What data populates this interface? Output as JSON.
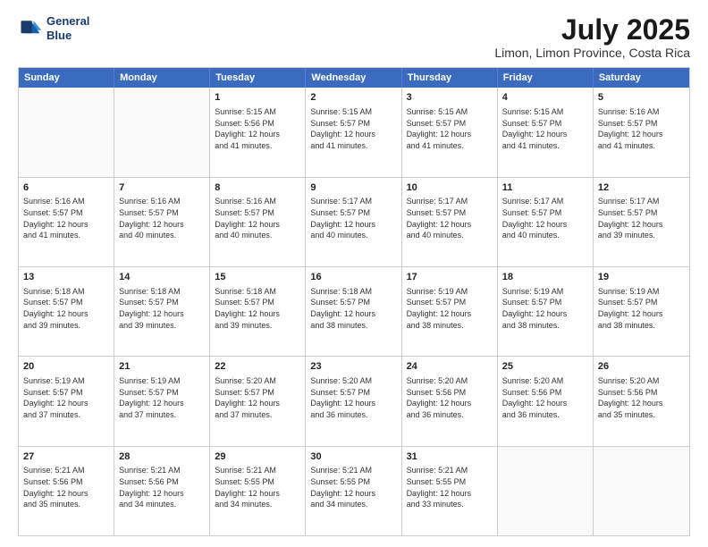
{
  "header": {
    "logo_line1": "General",
    "logo_line2": "Blue",
    "month": "July 2025",
    "location": "Limon, Limon Province, Costa Rica"
  },
  "weekdays": [
    "Sunday",
    "Monday",
    "Tuesday",
    "Wednesday",
    "Thursday",
    "Friday",
    "Saturday"
  ],
  "rows": [
    [
      {
        "day": "",
        "empty": true
      },
      {
        "day": "",
        "empty": true
      },
      {
        "day": "1",
        "line1": "Sunrise: 5:15 AM",
        "line2": "Sunset: 5:56 PM",
        "line3": "Daylight: 12 hours",
        "line4": "and 41 minutes."
      },
      {
        "day": "2",
        "line1": "Sunrise: 5:15 AM",
        "line2": "Sunset: 5:57 PM",
        "line3": "Daylight: 12 hours",
        "line4": "and 41 minutes."
      },
      {
        "day": "3",
        "line1": "Sunrise: 5:15 AM",
        "line2": "Sunset: 5:57 PM",
        "line3": "Daylight: 12 hours",
        "line4": "and 41 minutes."
      },
      {
        "day": "4",
        "line1": "Sunrise: 5:15 AM",
        "line2": "Sunset: 5:57 PM",
        "line3": "Daylight: 12 hours",
        "line4": "and 41 minutes."
      },
      {
        "day": "5",
        "line1": "Sunrise: 5:16 AM",
        "line2": "Sunset: 5:57 PM",
        "line3": "Daylight: 12 hours",
        "line4": "and 41 minutes."
      }
    ],
    [
      {
        "day": "6",
        "line1": "Sunrise: 5:16 AM",
        "line2": "Sunset: 5:57 PM",
        "line3": "Daylight: 12 hours",
        "line4": "and 41 minutes."
      },
      {
        "day": "7",
        "line1": "Sunrise: 5:16 AM",
        "line2": "Sunset: 5:57 PM",
        "line3": "Daylight: 12 hours",
        "line4": "and 40 minutes."
      },
      {
        "day": "8",
        "line1": "Sunrise: 5:16 AM",
        "line2": "Sunset: 5:57 PM",
        "line3": "Daylight: 12 hours",
        "line4": "and 40 minutes."
      },
      {
        "day": "9",
        "line1": "Sunrise: 5:17 AM",
        "line2": "Sunset: 5:57 PM",
        "line3": "Daylight: 12 hours",
        "line4": "and 40 minutes."
      },
      {
        "day": "10",
        "line1": "Sunrise: 5:17 AM",
        "line2": "Sunset: 5:57 PM",
        "line3": "Daylight: 12 hours",
        "line4": "and 40 minutes."
      },
      {
        "day": "11",
        "line1": "Sunrise: 5:17 AM",
        "line2": "Sunset: 5:57 PM",
        "line3": "Daylight: 12 hours",
        "line4": "and 40 minutes."
      },
      {
        "day": "12",
        "line1": "Sunrise: 5:17 AM",
        "line2": "Sunset: 5:57 PM",
        "line3": "Daylight: 12 hours",
        "line4": "and 39 minutes."
      }
    ],
    [
      {
        "day": "13",
        "line1": "Sunrise: 5:18 AM",
        "line2": "Sunset: 5:57 PM",
        "line3": "Daylight: 12 hours",
        "line4": "and 39 minutes."
      },
      {
        "day": "14",
        "line1": "Sunrise: 5:18 AM",
        "line2": "Sunset: 5:57 PM",
        "line3": "Daylight: 12 hours",
        "line4": "and 39 minutes."
      },
      {
        "day": "15",
        "line1": "Sunrise: 5:18 AM",
        "line2": "Sunset: 5:57 PM",
        "line3": "Daylight: 12 hours",
        "line4": "and 39 minutes."
      },
      {
        "day": "16",
        "line1": "Sunrise: 5:18 AM",
        "line2": "Sunset: 5:57 PM",
        "line3": "Daylight: 12 hours",
        "line4": "and 38 minutes."
      },
      {
        "day": "17",
        "line1": "Sunrise: 5:19 AM",
        "line2": "Sunset: 5:57 PM",
        "line3": "Daylight: 12 hours",
        "line4": "and 38 minutes."
      },
      {
        "day": "18",
        "line1": "Sunrise: 5:19 AM",
        "line2": "Sunset: 5:57 PM",
        "line3": "Daylight: 12 hours",
        "line4": "and 38 minutes."
      },
      {
        "day": "19",
        "line1": "Sunrise: 5:19 AM",
        "line2": "Sunset: 5:57 PM",
        "line3": "Daylight: 12 hours",
        "line4": "and 38 minutes."
      }
    ],
    [
      {
        "day": "20",
        "line1": "Sunrise: 5:19 AM",
        "line2": "Sunset: 5:57 PM",
        "line3": "Daylight: 12 hours",
        "line4": "and 37 minutes."
      },
      {
        "day": "21",
        "line1": "Sunrise: 5:19 AM",
        "line2": "Sunset: 5:57 PM",
        "line3": "Daylight: 12 hours",
        "line4": "and 37 minutes."
      },
      {
        "day": "22",
        "line1": "Sunrise: 5:20 AM",
        "line2": "Sunset: 5:57 PM",
        "line3": "Daylight: 12 hours",
        "line4": "and 37 minutes."
      },
      {
        "day": "23",
        "line1": "Sunrise: 5:20 AM",
        "line2": "Sunset: 5:57 PM",
        "line3": "Daylight: 12 hours",
        "line4": "and 36 minutes."
      },
      {
        "day": "24",
        "line1": "Sunrise: 5:20 AM",
        "line2": "Sunset: 5:56 PM",
        "line3": "Daylight: 12 hours",
        "line4": "and 36 minutes."
      },
      {
        "day": "25",
        "line1": "Sunrise: 5:20 AM",
        "line2": "Sunset: 5:56 PM",
        "line3": "Daylight: 12 hours",
        "line4": "and 36 minutes."
      },
      {
        "day": "26",
        "line1": "Sunrise: 5:20 AM",
        "line2": "Sunset: 5:56 PM",
        "line3": "Daylight: 12 hours",
        "line4": "and 35 minutes."
      }
    ],
    [
      {
        "day": "27",
        "line1": "Sunrise: 5:21 AM",
        "line2": "Sunset: 5:56 PM",
        "line3": "Daylight: 12 hours",
        "line4": "and 35 minutes."
      },
      {
        "day": "28",
        "line1": "Sunrise: 5:21 AM",
        "line2": "Sunset: 5:56 PM",
        "line3": "Daylight: 12 hours",
        "line4": "and 34 minutes."
      },
      {
        "day": "29",
        "line1": "Sunrise: 5:21 AM",
        "line2": "Sunset: 5:55 PM",
        "line3": "Daylight: 12 hours",
        "line4": "and 34 minutes."
      },
      {
        "day": "30",
        "line1": "Sunrise: 5:21 AM",
        "line2": "Sunset: 5:55 PM",
        "line3": "Daylight: 12 hours",
        "line4": "and 34 minutes."
      },
      {
        "day": "31",
        "line1": "Sunrise: 5:21 AM",
        "line2": "Sunset: 5:55 PM",
        "line3": "Daylight: 12 hours",
        "line4": "and 33 minutes."
      },
      {
        "day": "",
        "empty": true
      },
      {
        "day": "",
        "empty": true
      }
    ]
  ]
}
